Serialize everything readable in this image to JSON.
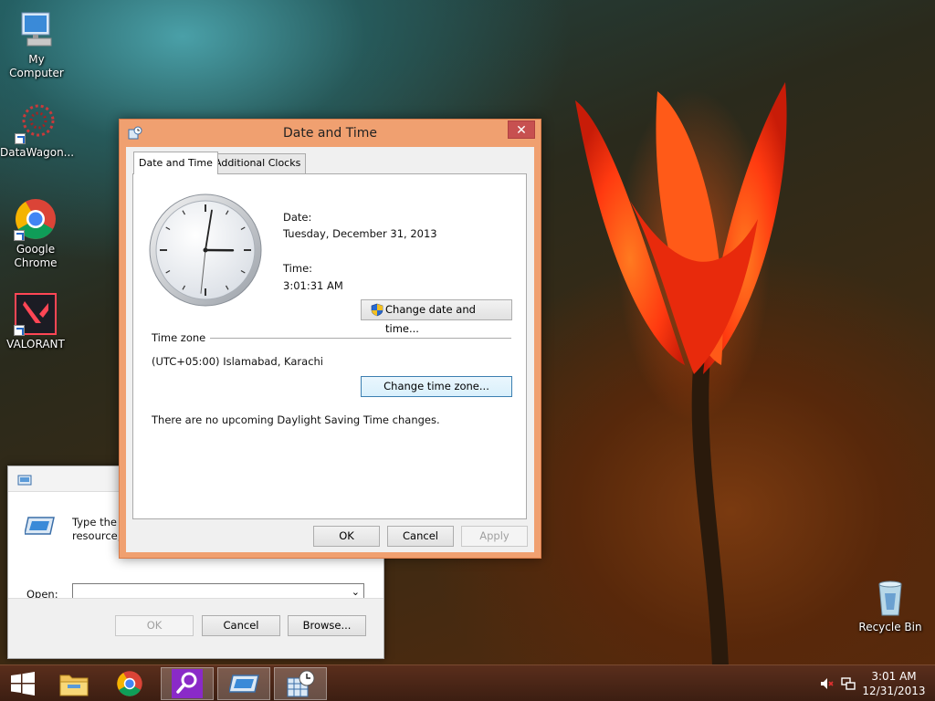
{
  "desktop": {
    "icons": [
      {
        "label": "My Computer",
        "icon": "computer-icon"
      },
      {
        "label": "DataWagon...",
        "icon": "datawagon-icon"
      },
      {
        "label": "Google Chrome",
        "icon": "chrome-icon"
      },
      {
        "label": "VALORANT",
        "icon": "valorant-icon"
      },
      {
        "label": "Recycle Bin",
        "icon": "recycle-bin-icon"
      }
    ]
  },
  "run_dialog": {
    "description": "Type the n\nresource,",
    "open_label": "Open:",
    "open_value": "",
    "ok_label": "OK",
    "cancel_label": "Cancel",
    "browse_label": "Browse..."
  },
  "datetime_dialog": {
    "title": "Date and Time",
    "tabs": [
      {
        "label": "Date and Time",
        "active": true
      },
      {
        "label": "Additional Clocks",
        "active": false
      }
    ],
    "clock": {
      "hour": 3,
      "minute": 1,
      "second": 31
    },
    "date_label": "Date:",
    "date_value": "Tuesday, December 31, 2013",
    "time_label": "Time:",
    "time_value": "3:01:31 AM",
    "change_datetime_label": "Change date and time...",
    "timezone_header": "Time zone",
    "timezone_value": "(UTC+05:00) Islamabad, Karachi",
    "change_timezone_label": "Change time zone...",
    "dst_message": "There are no upcoming Daylight Saving Time changes.",
    "ok_label": "OK",
    "cancel_label": "Cancel",
    "apply_label": "Apply"
  },
  "taskbar": {
    "items": [
      "start-icon",
      "file-explorer-icon",
      "chrome-icon",
      "search-app-icon",
      "run-icon",
      "datetime-icon"
    ],
    "tray": {
      "time": "3:01 AM",
      "date": "12/31/2013"
    }
  }
}
